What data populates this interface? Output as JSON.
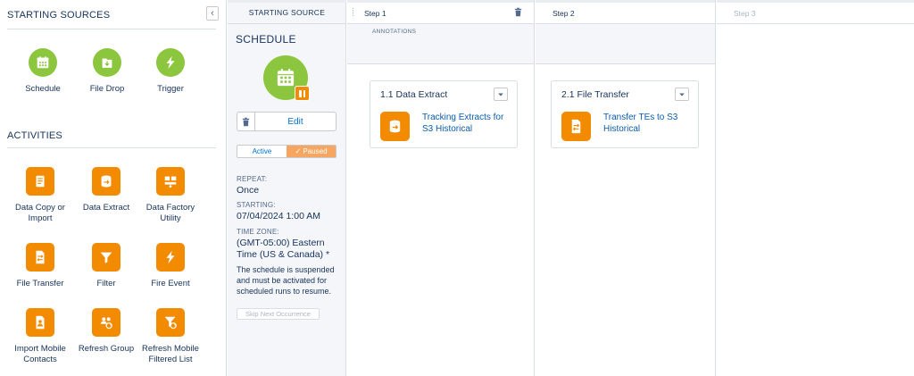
{
  "palette": {
    "starting_sources_title": "STARTING SOURCES",
    "collapse_glyph": "‹",
    "sources": [
      {
        "label": "Schedule",
        "icon": "calendar-icon"
      },
      {
        "label": "File Drop",
        "icon": "file-drop-icon"
      },
      {
        "label": "Trigger",
        "icon": "lightning-icon"
      }
    ],
    "activities_title": "ACTIVITIES",
    "activities": [
      {
        "label": "Data Copy or Import",
        "icon": "data-copy-icon"
      },
      {
        "label": "Data Extract",
        "icon": "data-extract-icon"
      },
      {
        "label": "Data Factory Utility",
        "icon": "data-factory-icon"
      },
      {
        "label": "File Transfer",
        "icon": "file-transfer-icon"
      },
      {
        "label": "Filter",
        "icon": "filter-icon"
      },
      {
        "label": "Fire Event",
        "icon": "lightning-icon"
      },
      {
        "label": "Import Mobile Contacts",
        "icon": "import-mobile-icon"
      },
      {
        "label": "Refresh Group",
        "icon": "refresh-group-icon"
      },
      {
        "label": "Refresh Mobile Filtered List",
        "icon": "refresh-mobile-icon"
      }
    ]
  },
  "source_panel": {
    "header": "STARTING SOURCE",
    "title": "SCHEDULE",
    "edit_label": "Edit",
    "toggle": {
      "active": "Active",
      "paused": "✓ Paused",
      "selected": "Paused"
    },
    "repeat_label": "REPEAT:",
    "repeat_value": "Once",
    "starting_label": "STARTING:",
    "starting_value": "07/04/2024 1:00 AM",
    "timezone_label": "TIME ZONE:",
    "timezone_value": "(GMT-05:00) Eastern Time (US & Canada) *",
    "note": "The schedule is suspended and must be activated for scheduled runs to resume.",
    "skip_label": "Skip Next Occurrence"
  },
  "annotations_label": "ANNOTATIONS",
  "steps": [
    {
      "title": "Step 1",
      "card": {
        "title": "1.1 Data Extract",
        "name": "Tracking Extracts for S3 Historical",
        "icon": "data-extract-icon"
      }
    },
    {
      "title": "Step 2",
      "card": {
        "title": "2.1 File Transfer",
        "name": "Transfer TEs to S3 Historical",
        "icon": "file-transfer-icon"
      }
    },
    {
      "title": "Step 3"
    }
  ],
  "colors": {
    "schedule_green": "#8cc63f",
    "activity_orange": "#f38b00",
    "paused_orange": "#f6a660",
    "link_blue": "#0070d2"
  }
}
